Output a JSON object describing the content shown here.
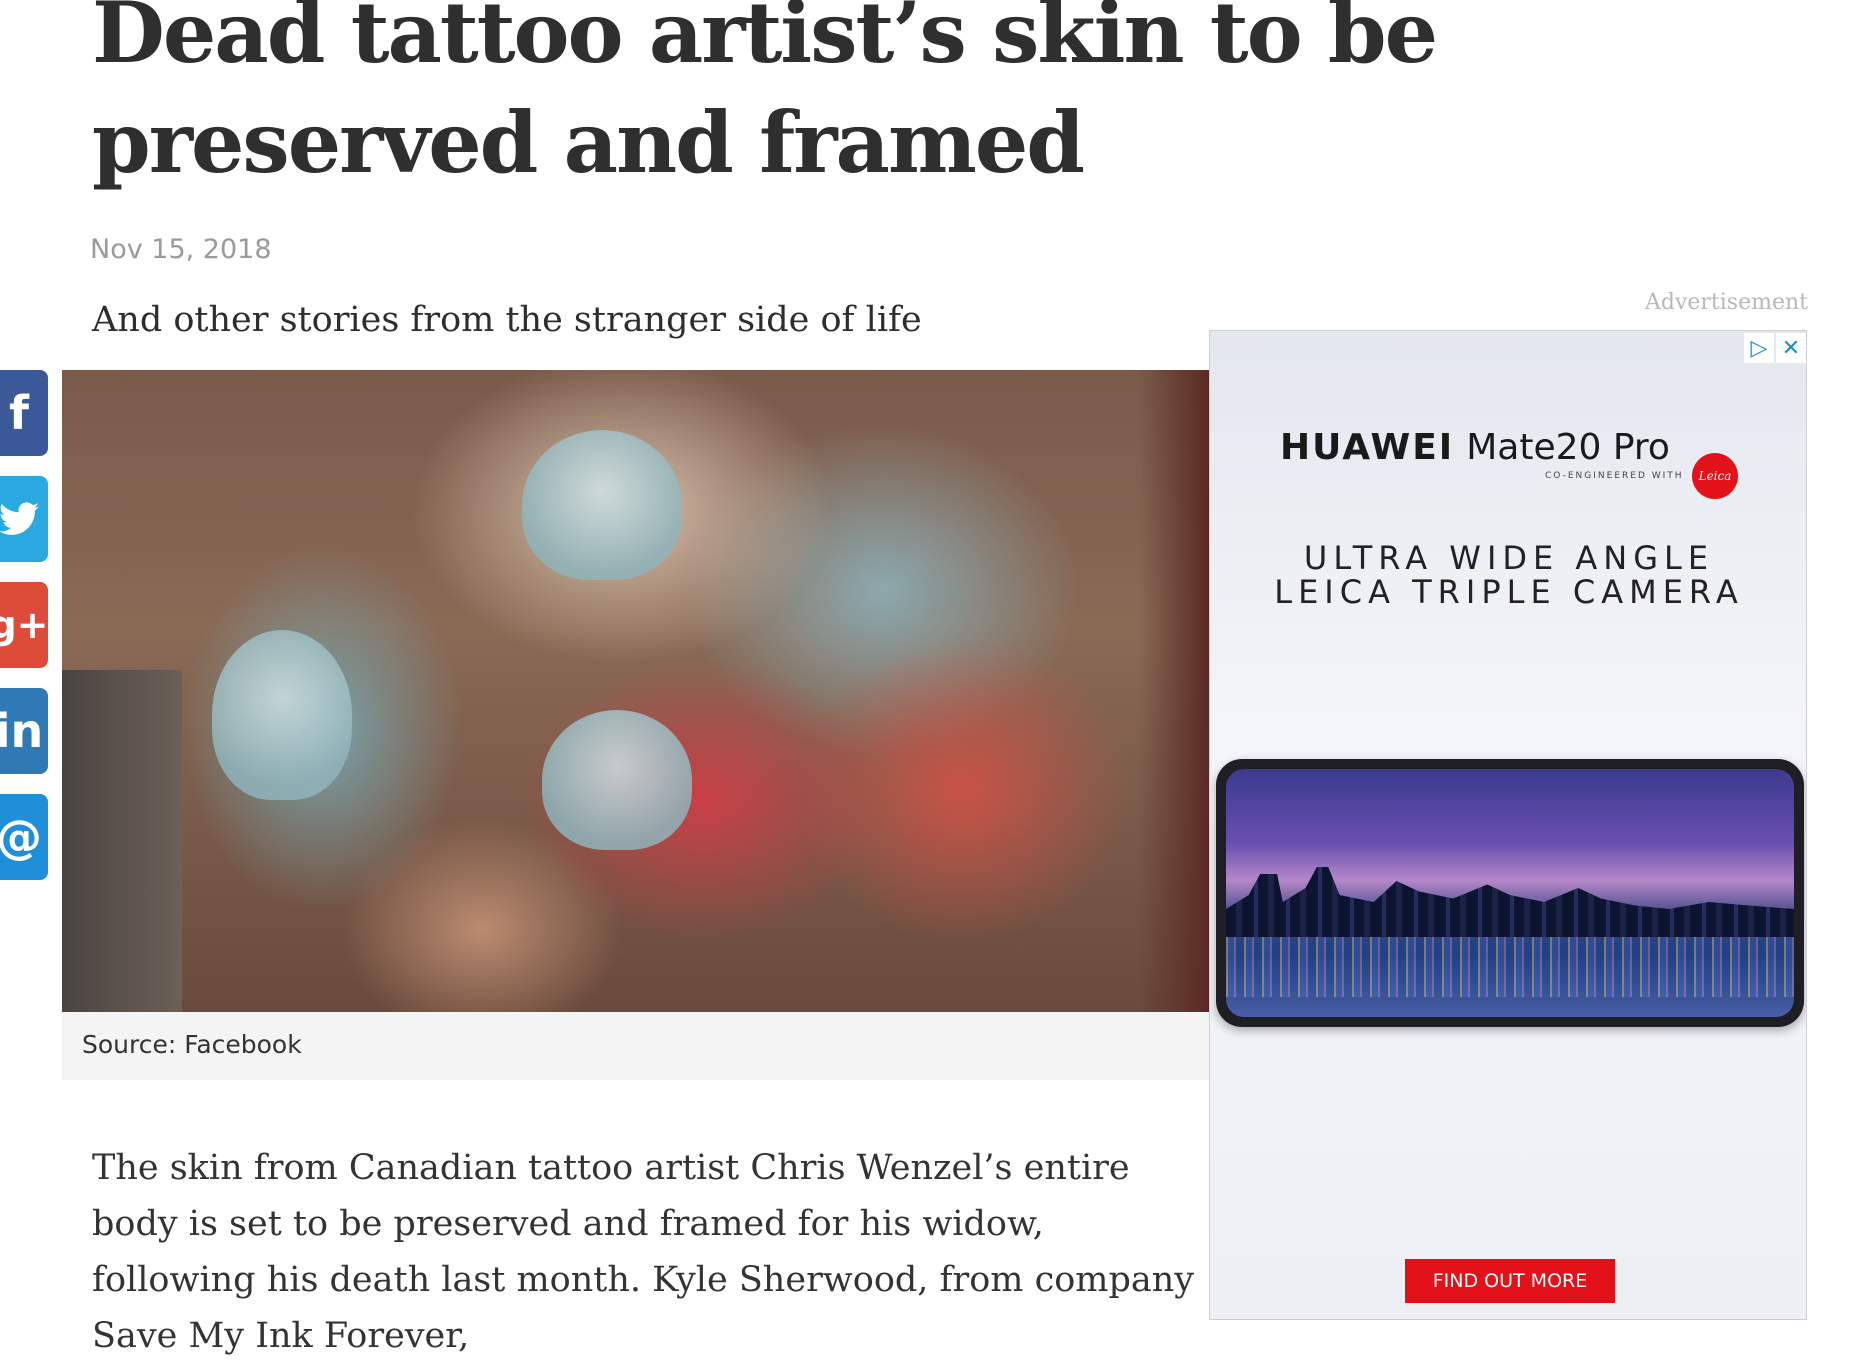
{
  "article": {
    "headline": "Dead tattoo artist’s skin to be preserved and framed",
    "date": "Nov 15, 2018",
    "standfirst": "And other stories from the stranger side of life",
    "image_caption": "Source: Facebook",
    "body": "The skin from Canadian tattoo artist Chris Wenzel’s entire body is set to be preserved and framed for his widow, following his death last month. Kyle Sherwood, from company Save My Ink Forever,"
  },
  "share": {
    "facebook": "f",
    "twitter": "🐦",
    "googleplus": "g+",
    "linkedin": "in",
    "email": "@"
  },
  "ad": {
    "label": "Advertisement",
    "brand": "HUAWEI",
    "model": "Mate20 Pro",
    "co_engineered": "CO-ENGINEERED WITH",
    "leica_logo": "Leica",
    "headline_line1": "ULTRA WIDE ANGLE",
    "headline_line2": "LEICA TRIPLE CAMERA",
    "cta": "FIND OUT MORE",
    "adchoices_icon": "▷",
    "close_icon": "✕"
  }
}
